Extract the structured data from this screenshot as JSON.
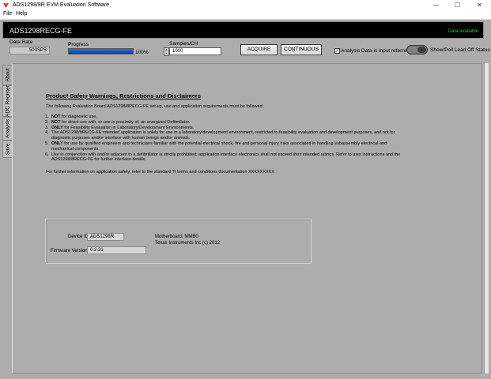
{
  "window": {
    "title": "ADS1298/8R EVM Evaluation Software",
    "minimize_glyph": "—",
    "maximize_glyph": "☐",
    "close_glyph": "✕"
  },
  "menu": {
    "items": [
      {
        "label": "File"
      },
      {
        "label": "Help"
      }
    ]
  },
  "header": {
    "title": "ADS1298RECG-FE",
    "status": "Data available",
    "status_color": "#1fd01f"
  },
  "controls": {
    "data_rate_label": "Data Rate",
    "data_rate_value": "500SPS",
    "progress_label": "Progress",
    "progress_value": "100%",
    "progress_fraction": 1.0,
    "samples_label": "Samples/CH",
    "samples_value": "1000",
    "acquire_label": "ACQUIRE",
    "continuous_label": "CONTINUOUS",
    "analysis_checkbox_label": "Analysis Data is input referred",
    "analysis_checked": true,
    "lead_off_label": "Show/Poll Lead Off Status"
  },
  "tabs": [
    {
      "label": "About"
    },
    {
      "label": "ADC Register"
    },
    {
      "label": "Analysis"
    },
    {
      "label": "Save"
    }
  ],
  "about": {
    "heading": "Product Safety Warnings, Restrictions and Disclaimers",
    "intro": "The following Evaluation Board ADS1298/8RECG-FE set-up, use and application requirements must be followed:",
    "warnings": [
      {
        "num": "1.",
        "bold": "NOT",
        "text": " for diagnostic use."
      },
      {
        "num": "2.",
        "bold": "NOT",
        "text": " for direct use with, or use in proximity of, an energized Defibrillator."
      },
      {
        "num": "3.",
        "bold": "ONLY",
        "text": " for Feasibility Evaluation in Laboratory/Development Environments."
      },
      {
        "num": "4.",
        "bold": "",
        "text": "The ADS1298/8RECG-FE intended application is solely for use in a laboratory/development environment, restricted to feasibility evaluation and development purposes, and not for diagnostic purposes and/or interface with human beings and/or animals."
      },
      {
        "num": "5.",
        "bold": "ONLY",
        "text": " for use by qualified engineers and technicians familiar with the potential electrical shock, fire and personal injury risks associated in handling subassembly electrical and mechanical components."
      },
      {
        "num": "6.",
        "bold": "",
        "text": "Use in conjunction with and/or adjacent to a defibrillator is strictly prohibited; application interface electronics shall not exceed their intended ratings. Refer to user instructions and the ADS1298/8RECG-FE for further interface details."
      }
    ],
    "footer": "For further information on application safety, refer to the standard TI terms and conditions documentation XXXXXXXXX",
    "device_id_label": "Device ID",
    "device_id_value": "ADS1298R",
    "firmware_label": "Firmware Version",
    "firmware_value": "0.2.31",
    "motherboard": "Motherboard:  MMB0",
    "copyright": "Texas Instruments Inc (c) 2012"
  }
}
